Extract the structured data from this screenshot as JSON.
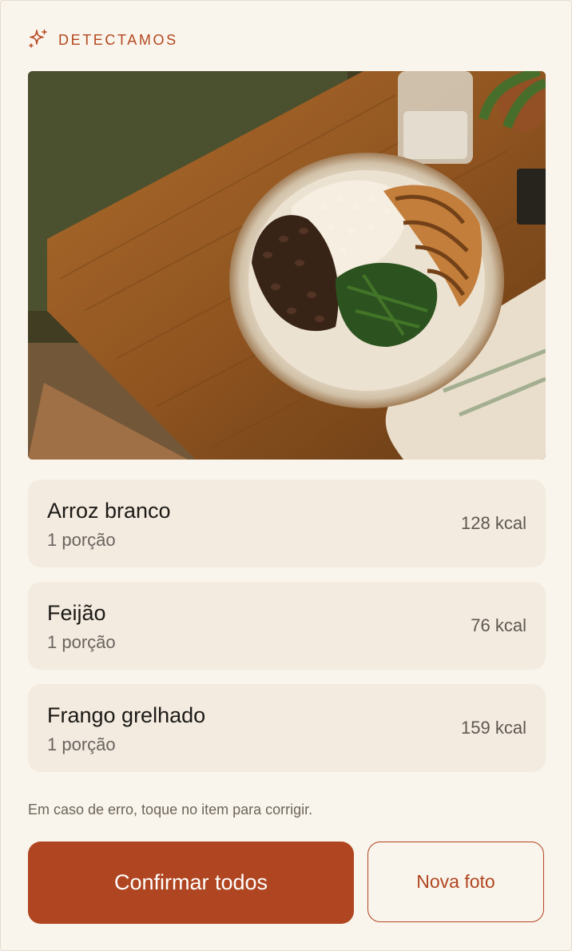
{
  "header": {
    "title": "DETECTAMOS",
    "icon": "sparkle-icon",
    "accent": "#b4471f"
  },
  "photo": {
    "icon": "food-photo"
  },
  "items": [
    {
      "name": "Arroz branco",
      "portion": "1 porção",
      "kcal": "128 kcal"
    },
    {
      "name": "Feijão",
      "portion": "1 porção",
      "kcal": "76 kcal"
    },
    {
      "name": "Frango grelhado",
      "portion": "1 porção",
      "kcal": "159 kcal"
    }
  ],
  "hint": "Em caso de erro, toque no item para corrigir.",
  "actions": {
    "confirm_label": "Confirmar todos",
    "new_photo_label": "Nova foto"
  },
  "colors": {
    "primary": "#b04621",
    "card": "#f3ebdf",
    "background": "#faf5ec"
  }
}
